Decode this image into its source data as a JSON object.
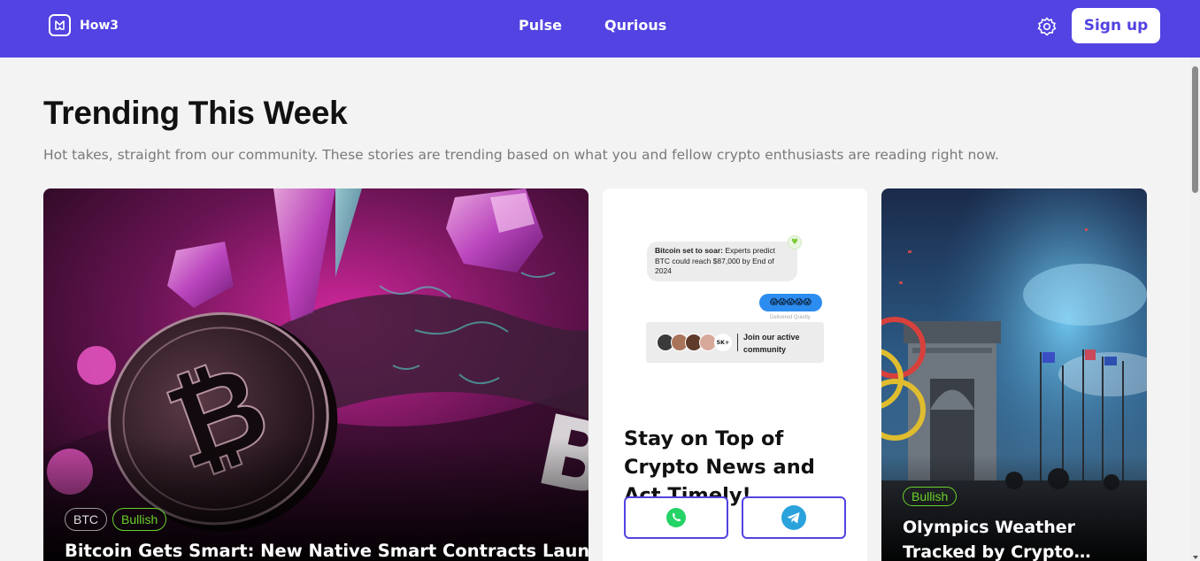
{
  "nav": {
    "logo_text": "How3",
    "links": [
      "Pulse",
      "Qurious"
    ],
    "signup_label": "Sign up"
  },
  "header": {
    "title": "Trending This Week",
    "subtitle": "Hot takes, straight from our community. These stories are trending based on what you and fellow crypto enthusiasts are reading right now."
  },
  "cards": {
    "main": {
      "tags": [
        "BTC",
        "Bullish"
      ],
      "title": "Bitcoin Gets Smart: New Native Smart Contracts Launched"
    },
    "promo": {
      "chat_message_bold": "Bitcoin set to soar:",
      "chat_message_rest": " Experts predict BTC could reach $87,000 by End of 2024",
      "reaction_emojis": "😱😱😱😱😱",
      "delivered": "Delivered Quietly",
      "member_count": "5K+",
      "join_text": "Join our active community",
      "headline": "Stay on Top of Crypto News and Act Timely!",
      "buttons": [
        "whatsapp",
        "telegram"
      ]
    },
    "right": {
      "tags": [
        "Bullish"
      ],
      "title": "Olympics Weather Tracked by Crypto…"
    }
  },
  "colors": {
    "brand": "#5243e2",
    "bullish": "#6bd12a",
    "whatsapp": "#25d366",
    "telegram": "#2aa3dc"
  },
  "icons": [
    "logo-icon",
    "gear-icon",
    "heart-icon",
    "whatsapp-icon",
    "telegram-icon"
  ]
}
